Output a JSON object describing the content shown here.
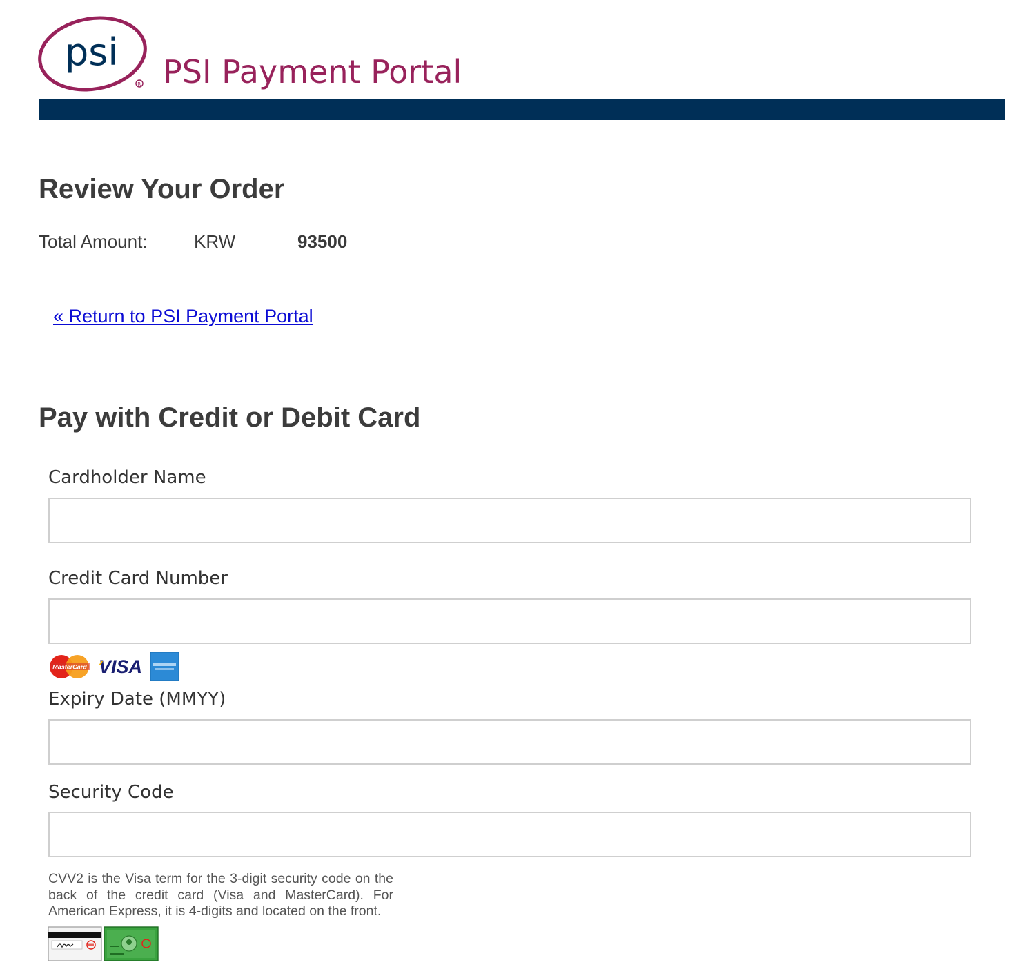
{
  "header": {
    "logo_text": "psi",
    "title": "PSI Payment Portal"
  },
  "order": {
    "heading": "Review Your Order",
    "total_label": "Total Amount:",
    "currency": "KRW",
    "amount": "93500"
  },
  "return_link": "« Return to PSI Payment Portal",
  "payment": {
    "heading": "Pay with Credit or Debit Card",
    "fields": {
      "cardholder_name": {
        "label": "Cardholder Name",
        "value": "",
        "placeholder": ""
      },
      "card_number": {
        "label": "Credit Card Number",
        "value": "",
        "placeholder": ""
      },
      "expiry": {
        "label": "Expiry Date (MMYY)",
        "value": "",
        "placeholder": ""
      },
      "security_code": {
        "label": "Security Code",
        "value": "",
        "placeholder": ""
      }
    },
    "card_brands": [
      "MasterCard",
      "VISA",
      "American Express"
    ],
    "cvv_help": "CVV2 is the Visa term for the 3-digit security code on the back of the credit card (Visa and MasterCard). For American Express, it is 4-digits and located on the front."
  },
  "colors": {
    "brand_magenta": "#98225b",
    "header_bar": "#002f57",
    "link": "#0b0bd4",
    "heading_text": "#3c3c3c"
  }
}
